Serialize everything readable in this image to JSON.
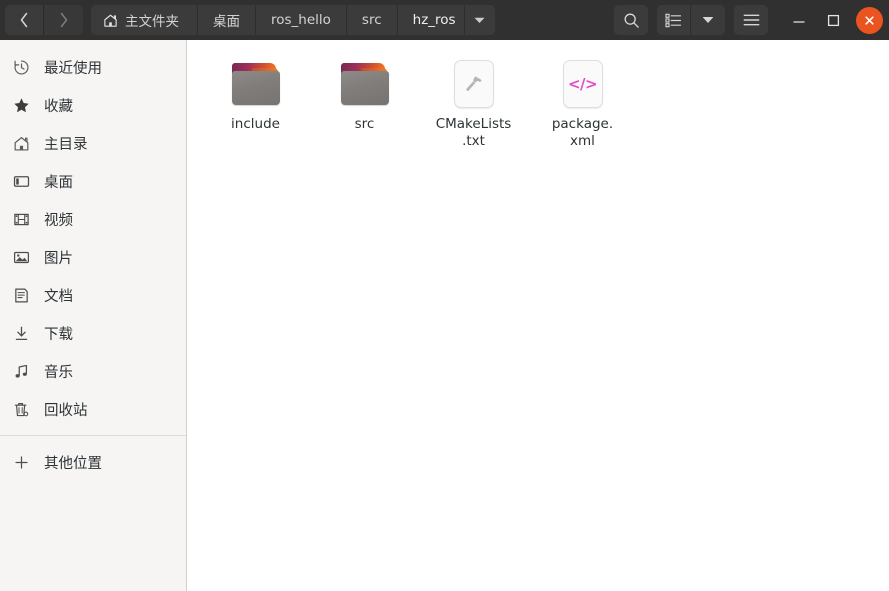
{
  "window": {
    "title": "hz_ros",
    "accent_color": "#e95420",
    "header_bg": "#303030",
    "sidebar_bg": "#f6f5f4",
    "content_bg": "#ffffff"
  },
  "header": {
    "nav": {
      "back_label": "‹",
      "back_name": "back-button",
      "forward_label": "›",
      "forward_name": "forward-button"
    },
    "breadcrumbs": [
      {
        "label": "主文件夹",
        "icon": "home-icon",
        "current": false
      },
      {
        "label": "桌面",
        "icon": "",
        "current": false
      },
      {
        "label": "ros_hello",
        "icon": "",
        "current": false
      },
      {
        "label": "src",
        "icon": "",
        "current": false
      },
      {
        "label": "hz_ros",
        "icon": "",
        "current": true
      }
    ],
    "breadcrumb_caret": "▼",
    "buttons": {
      "search": "search-icon",
      "view_list": "list-view-icon",
      "view_dropdown": "▼",
      "menu": "hamburger-menu-icon"
    },
    "window_controls": {
      "minimize": "–",
      "maximize": "□",
      "close": "×"
    }
  },
  "sidebar": {
    "items": [
      {
        "label": "最近使用",
        "icon": "clock-icon",
        "name": "sidebar-item-recent"
      },
      {
        "label": "收藏",
        "icon": "star-icon",
        "name": "sidebar-item-starred"
      },
      {
        "label": "主目录",
        "icon": "home-icon",
        "name": "sidebar-item-home"
      },
      {
        "label": "桌面",
        "icon": "desktop-icon",
        "name": "sidebar-item-desktop"
      },
      {
        "label": "视频",
        "icon": "video-icon",
        "name": "sidebar-item-videos"
      },
      {
        "label": "图片",
        "icon": "picture-icon",
        "name": "sidebar-item-pictures"
      },
      {
        "label": "文档",
        "icon": "document-icon",
        "name": "sidebar-item-documents"
      },
      {
        "label": "下载",
        "icon": "download-icon",
        "name": "sidebar-item-downloads"
      },
      {
        "label": "音乐",
        "icon": "music-icon",
        "name": "sidebar-item-music"
      },
      {
        "label": "回收站",
        "icon": "trash-icon",
        "name": "sidebar-item-trash"
      }
    ],
    "other_locations": {
      "label": "其他位置",
      "icon": "plus-icon",
      "name": "sidebar-item-other-locations"
    }
  },
  "files": [
    {
      "name": "include",
      "type": "folder"
    },
    {
      "name": "src",
      "type": "folder"
    },
    {
      "name": "CMakeLists\n.txt",
      "label_line1": "CMakeLists",
      "label_line2": ".txt",
      "type": "file",
      "icon": "hammer-icon"
    },
    {
      "name": "package.\nxml",
      "label_line1": "package.",
      "label_line2": "xml",
      "type": "file",
      "icon": "code-icon"
    }
  ]
}
